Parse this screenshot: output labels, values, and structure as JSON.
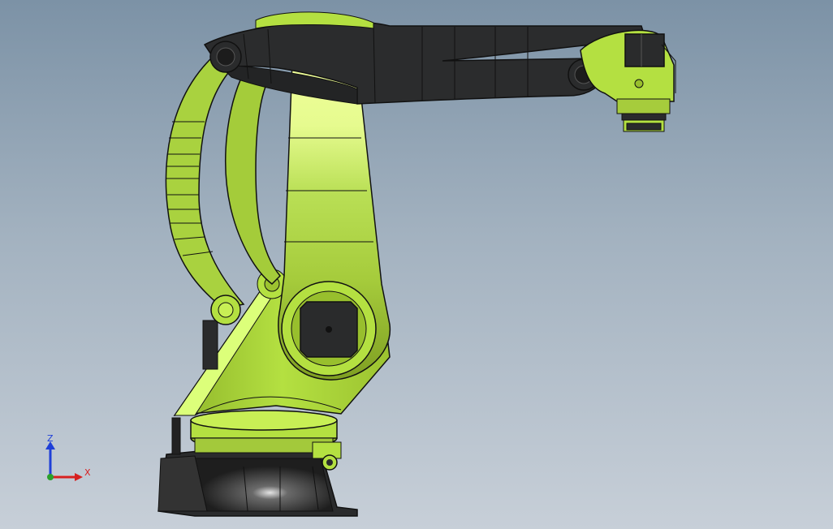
{
  "viewport": {
    "background_top": "#7c92a6",
    "background_bottom": "#c7cfd8"
  },
  "model": {
    "subject": "palletizing-robot-arm",
    "body_color": "#b4e041",
    "body_shade_color": "#8fb52a",
    "body_highlight_color": "#eaff98",
    "dark_part_color": "#2a2b2c",
    "outline_color": "#1a1a1a"
  },
  "triad": {
    "z_label": "Z",
    "x_label": "X",
    "z_color": "#1f3fd8",
    "x_color": "#d62020",
    "y_color": "#2aa02a"
  }
}
